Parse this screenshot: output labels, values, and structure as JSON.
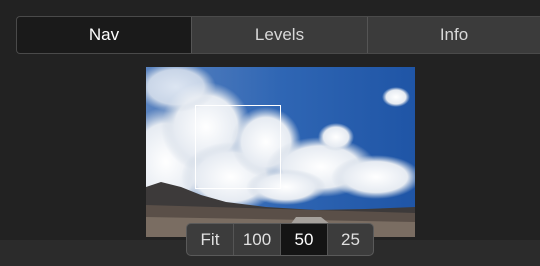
{
  "tabs": [
    {
      "label": "Nav",
      "active": true
    },
    {
      "label": "Levels",
      "active": false
    },
    {
      "label": "Info",
      "active": false
    }
  ],
  "navigator": {
    "image": "sky-clouds-desert-road-preview"
  },
  "zoom": {
    "options": [
      "Fit",
      "100",
      "50",
      "25"
    ],
    "selected": "50"
  },
  "colors": {
    "active_tab": "#1a1a1a",
    "inactive_tab": "#3b3b3b",
    "selected_zoom": "#141414"
  }
}
